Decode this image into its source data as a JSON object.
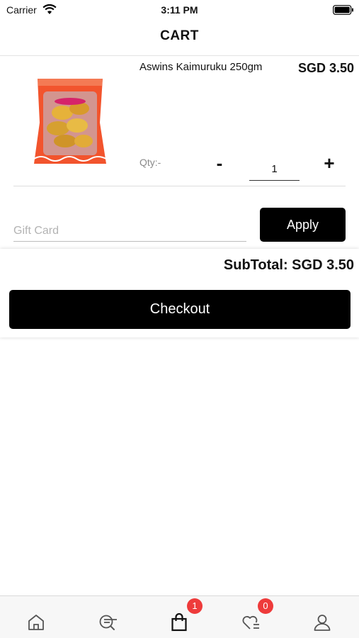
{
  "status_bar": {
    "carrier": "Carrier",
    "time": "3:11 PM"
  },
  "header": {
    "title": "CART"
  },
  "cart_item": {
    "name": "Aswins Kaimuruku 250gm",
    "price": "SGD 3.50",
    "qty_label": "Qty:-",
    "minus_label": "-",
    "plus_label": "+",
    "quantity": "1"
  },
  "gift_card": {
    "placeholder": "Gift Card",
    "apply_label": "Apply"
  },
  "summary": {
    "subtotal": "SubTotal: SGD 3.50",
    "checkout_label": "Checkout"
  },
  "tabs": [
    {
      "name": "home",
      "icon": "home-icon"
    },
    {
      "name": "search",
      "icon": "search-list-icon"
    },
    {
      "name": "cart",
      "icon": "shopping-bag-icon",
      "badge": "1"
    },
    {
      "name": "wishlist",
      "icon": "heart-list-icon",
      "badge": "0"
    },
    {
      "name": "profile",
      "icon": "user-icon"
    }
  ],
  "colors": {
    "accent": "#000000",
    "badge": "#ee3b3b",
    "package": "#f2542d"
  }
}
